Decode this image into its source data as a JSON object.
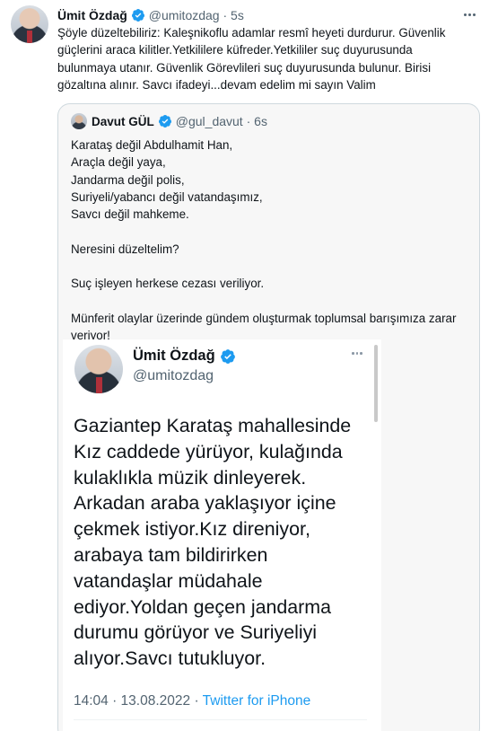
{
  "tweet": {
    "author_name": "Ümit Özdağ",
    "author_handle": "@umitozdag",
    "time": "5s",
    "text": "Şöyle düzeltebiliriz: Kaleşnikoflu adamlar resmî heyeti durdurur. Güvenlik\ngüçlerini araca kilitler.Yetkililere küfreder.Yetkililer suç duyurusunda\nbulunmaya utanır. Güvenlik Görevlileri suç duyurusunda bulunur. Birisi\ngözaltına alınır. Savcı ifadeyi...devam edelim mi sayın Valim",
    "verified_color": "#1d9bf0"
  },
  "quoted_tweet": {
    "author_name": "Davut GÜL",
    "author_handle": "@gul_davut",
    "time": "6s",
    "text": "Karataş değil Abdulhamit Han,\nAraçla değil yaya,\nJandarma değil polis,\nSuriyeli/yabancı değil vatandaşımız,\nSavcı değil mahkeme.\n\nNeresini düzeltelim?\n\nSuç işleyen herkese cezası veriliyor.\n\nMünferit olaylar üzerinde gündem oluşturmak toplumsal barışımıza zarar\nveriyor!"
  },
  "embedded_screenshot": {
    "author_name": "Ümit Özdağ",
    "author_handle": "@umitozdag",
    "text": "Gaziantep Karataş mahallesinde\nKız caddede yürüyor, kulağında\nkulaklıkla müzik dinleyerek.\nArkadan araba yaklaşıyor içine\nçekmek istiyor.Kız direniyor,\narabaya tam bildirirken\nvatandaşlar müdahale\nediyor.Yoldan geçen jandarma\ndurumu görüyor ve Suriyeliyi\nalıyor.Savcı tutukluyor.",
    "timestamp": "14:04 · 13.08.2022 · ",
    "source": "Twitter for iPhone"
  },
  "icons": {
    "verified": "verified-badge-icon",
    "more": "more-horizontal-icon"
  }
}
